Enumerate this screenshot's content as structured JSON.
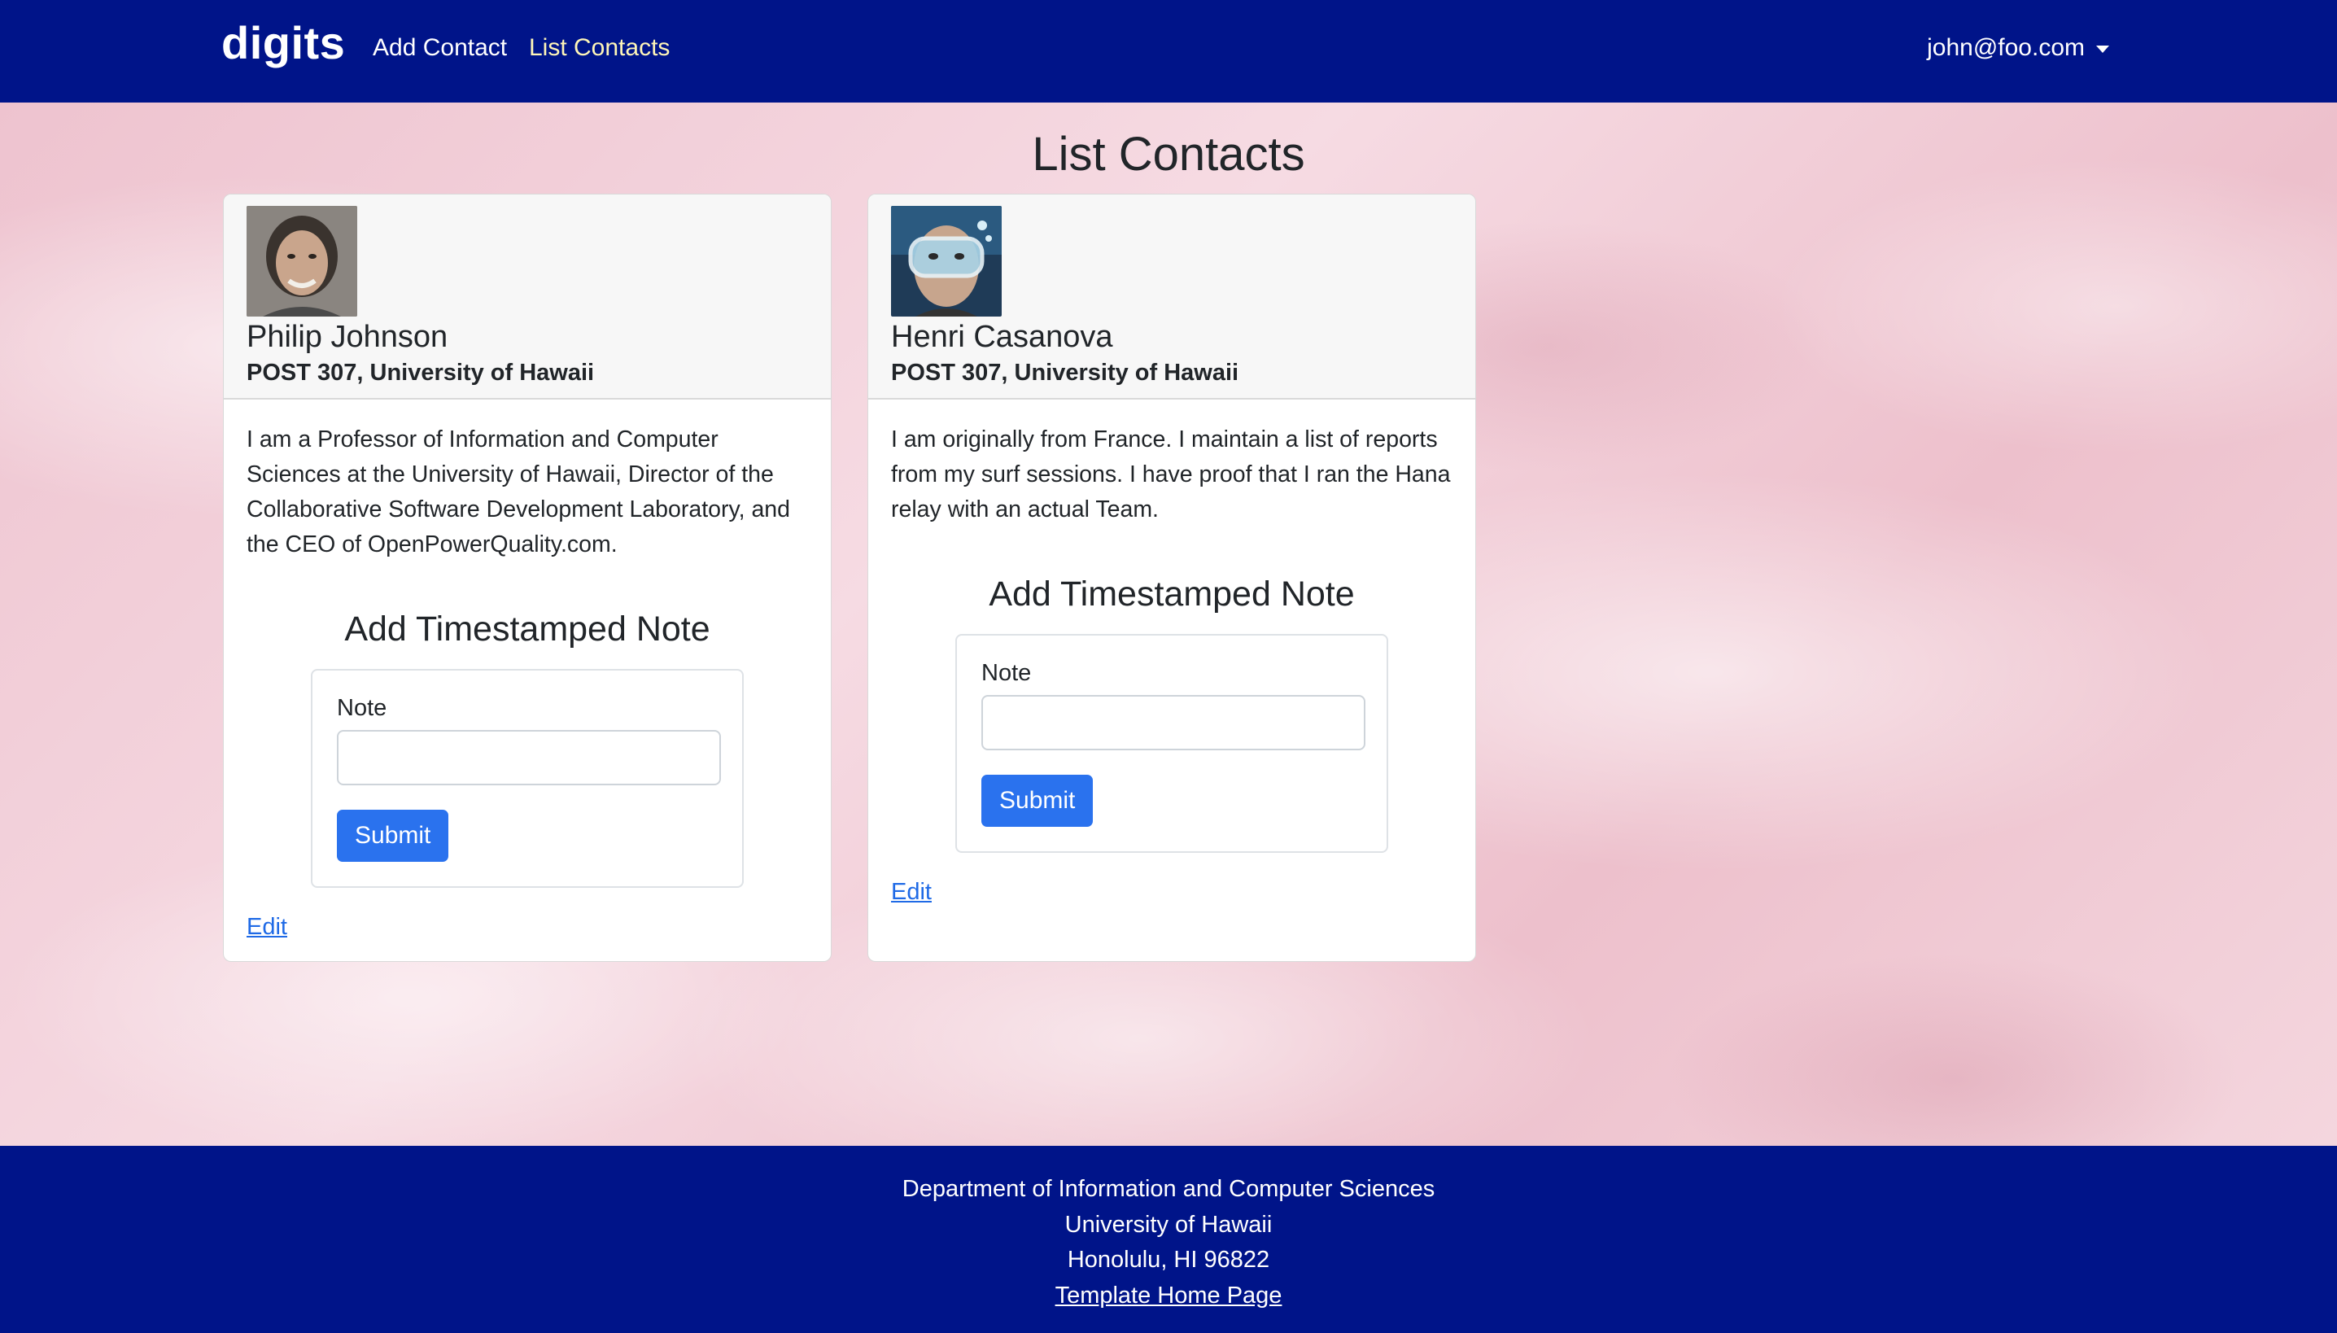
{
  "navbar": {
    "brand": "digits",
    "links": [
      {
        "label": "Add Contact"
      },
      {
        "label": "List Contacts"
      }
    ],
    "user": "john@foo.com",
    "active_color": "#fff6b8",
    "bg_color": "#001489"
  },
  "page": {
    "title": "List Contacts"
  },
  "contacts": [
    {
      "name": "Philip Johnson",
      "address": "POST 307, University of Hawaii",
      "description": "I am a Professor of Information and Computer Sciences at the University of Hawaii, Director of the Collaborative Software Development Laboratory, and the CEO of OpenPowerQuality.com.",
      "note_title": "Add Timestamped Note",
      "note_label": "Note",
      "note_value": "",
      "submit_label": "Submit",
      "edit_label": "Edit"
    },
    {
      "name": "Henri Casanova",
      "address": "POST 307, University of Hawaii",
      "description": "I am originally from France. I maintain a list of reports from my surf sessions. I have proof that I ran the Hana relay with an actual Team.",
      "note_title": "Add Timestamped Note",
      "note_label": "Note",
      "note_value": "",
      "submit_label": "Submit",
      "edit_label": "Edit"
    }
  ],
  "footer": {
    "line1": "Department of Information and Computer Sciences",
    "line2": "University of Hawaii",
    "line3": "Honolulu, HI 96822",
    "link": "Template Home Page"
  }
}
